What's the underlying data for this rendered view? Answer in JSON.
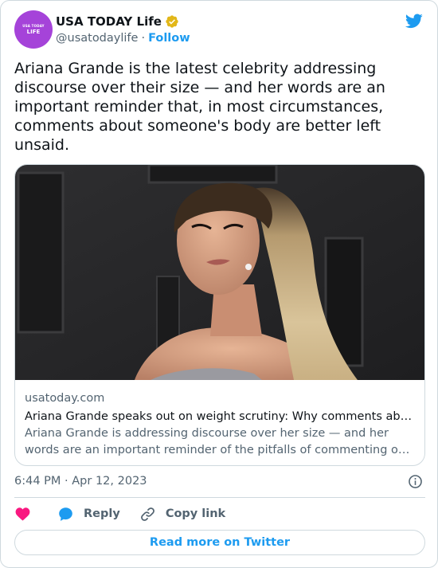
{
  "author": {
    "avatar_line1": "USA TODAY",
    "avatar_line2": "LIFE",
    "display_name": "USA TODAY Life",
    "handle": "@usatodaylife",
    "separator": "·",
    "follow_label": "Follow",
    "verified_color": "#e2b719"
  },
  "tweet": {
    "text": "Ariana Grande is the latest celebrity addressing discourse over their size — and her words are an important reminder that, in most circumstances, comments about someone's body are better left unsaid."
  },
  "link_card": {
    "domain": "usatoday.com",
    "title": "Ariana Grande speaks out on weight scrutiny: Why comments about someone's body are better left unsaid",
    "description_line1": "Ariana Grande is addressing discourse over her size — and her",
    "description_line2": "words are an important reminder of the pitfalls of commenting on someone's body"
  },
  "meta": {
    "timestamp": "6:44 PM · Apr 12, 2023"
  },
  "actions": {
    "reply_label": "Reply",
    "copy_link_label": "Copy link"
  },
  "read_more_label": "Read more on Twitter",
  "colors": {
    "accent": "#1d9bf0",
    "heart": "#f91880",
    "avatar_bg": "#a543d9"
  }
}
